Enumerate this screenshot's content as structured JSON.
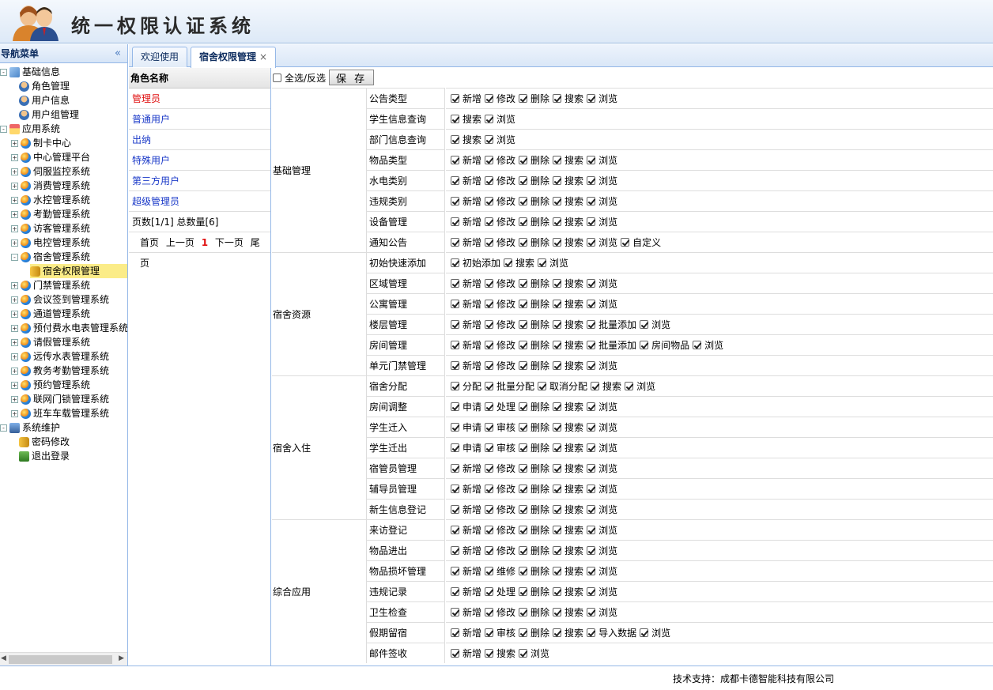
{
  "header": {
    "title": "统一权限认证系统"
  },
  "sidebar": {
    "title": "导航菜单",
    "tree": [
      {
        "label": "基础信息",
        "level": 0,
        "toggle": "-",
        "icon": "folder"
      },
      {
        "label": "角色管理",
        "level": 2,
        "icon": "user"
      },
      {
        "label": "用户信息",
        "level": 2,
        "icon": "user"
      },
      {
        "label": "用户组管理",
        "level": 2,
        "icon": "user"
      },
      {
        "label": "应用系统",
        "level": 0,
        "toggle": "-",
        "icon": "home"
      },
      {
        "label": "制卡中心",
        "level": 1,
        "toggle": "+",
        "icon": "ball"
      },
      {
        "label": "中心管理平台",
        "level": 1,
        "toggle": "+",
        "icon": "ball"
      },
      {
        "label": "伺服监控系统",
        "level": 1,
        "toggle": "+",
        "icon": "ball"
      },
      {
        "label": "消费管理系统",
        "level": 1,
        "toggle": "+",
        "icon": "ball"
      },
      {
        "label": "水控管理系统",
        "level": 1,
        "toggle": "+",
        "icon": "ball"
      },
      {
        "label": "考勤管理系统",
        "level": 1,
        "toggle": "+",
        "icon": "ball"
      },
      {
        "label": "访客管理系统",
        "level": 1,
        "toggle": "+",
        "icon": "ball"
      },
      {
        "label": "电控管理系统",
        "level": 1,
        "toggle": "+",
        "icon": "ball"
      },
      {
        "label": "宿舍管理系统",
        "level": 1,
        "toggle": "-",
        "icon": "ball"
      },
      {
        "label": "宿舍权限管理",
        "level": 3,
        "icon": "key",
        "selected": true
      },
      {
        "label": "门禁管理系统",
        "level": 1,
        "toggle": "+",
        "icon": "ball"
      },
      {
        "label": "会议签到管理系统",
        "level": 1,
        "toggle": "+",
        "icon": "ball"
      },
      {
        "label": "通道管理系统",
        "level": 1,
        "toggle": "+",
        "icon": "ball"
      },
      {
        "label": "预付费水电表管理系统",
        "level": 1,
        "toggle": "+",
        "icon": "ball"
      },
      {
        "label": "请假管理系统",
        "level": 1,
        "toggle": "+",
        "icon": "ball"
      },
      {
        "label": "远传水表管理系统",
        "level": 1,
        "toggle": "+",
        "icon": "ball"
      },
      {
        "label": "教务考勤管理系统",
        "level": 1,
        "toggle": "+",
        "icon": "ball"
      },
      {
        "label": "预约管理系统",
        "level": 1,
        "toggle": "+",
        "icon": "ball"
      },
      {
        "label": "联网门锁管理系统",
        "level": 1,
        "toggle": "+",
        "icon": "ball"
      },
      {
        "label": "班车车载管理系统",
        "level": 1,
        "toggle": "+",
        "icon": "ball"
      },
      {
        "label": "系统维护",
        "level": 0,
        "toggle": "-",
        "icon": "pc"
      },
      {
        "label": "密码修改",
        "level": 2,
        "icon": "key"
      },
      {
        "label": "退出登录",
        "level": 2,
        "icon": "exit"
      }
    ]
  },
  "tabs": [
    {
      "label": "欢迎使用",
      "active": false
    },
    {
      "label": "宿舍权限管理",
      "active": true,
      "close": "×"
    }
  ],
  "roles": {
    "header": "角色名称",
    "items": [
      "管理员",
      "普通用户",
      "出纳",
      "特殊用户",
      "第三方用户",
      "超级管理员"
    ],
    "current": 0,
    "info": "页数[1/1]  总数量[6]",
    "pager": {
      "first": "首页",
      "prev": "上一页",
      "page": "1",
      "next": "下一页",
      "last": "尾页"
    }
  },
  "toolbar": {
    "select_all": "全选/反选",
    "save": "保 存"
  },
  "groups": [
    {
      "name": "基础管理",
      "modules": [
        {
          "name": "公告类型",
          "actions": [
            "新增",
            "修改",
            "删除",
            "搜索",
            "浏览"
          ]
        },
        {
          "name": "学生信息查询",
          "actions": [
            "搜索",
            "浏览"
          ]
        },
        {
          "name": "部门信息查询",
          "actions": [
            "搜索",
            "浏览"
          ]
        },
        {
          "name": "物品类型",
          "actions": [
            "新增",
            "修改",
            "删除",
            "搜索",
            "浏览"
          ]
        },
        {
          "name": "水电类别",
          "actions": [
            "新增",
            "修改",
            "删除",
            "搜索",
            "浏览"
          ]
        },
        {
          "name": "违规类别",
          "actions": [
            "新增",
            "修改",
            "删除",
            "搜索",
            "浏览"
          ]
        },
        {
          "name": "设备管理",
          "actions": [
            "新增",
            "修改",
            "删除",
            "搜索",
            "浏览"
          ]
        },
        {
          "name": "通知公告",
          "actions": [
            "新增",
            "修改",
            "删除",
            "搜索",
            "浏览",
            "自定义"
          ]
        }
      ]
    },
    {
      "name": "宿舍资源",
      "modules": [
        {
          "name": "初始快速添加",
          "actions": [
            "初始添加",
            "搜索",
            "浏览"
          ]
        },
        {
          "name": "区域管理",
          "actions": [
            "新增",
            "修改",
            "删除",
            "搜索",
            "浏览"
          ]
        },
        {
          "name": "公寓管理",
          "actions": [
            "新增",
            "修改",
            "删除",
            "搜索",
            "浏览"
          ]
        },
        {
          "name": "楼层管理",
          "actions": [
            "新增",
            "修改",
            "删除",
            "搜索",
            "批量添加",
            "浏览"
          ]
        },
        {
          "name": "房间管理",
          "actions": [
            "新增",
            "修改",
            "删除",
            "搜索",
            "批量添加",
            "房间物品",
            "浏览"
          ]
        },
        {
          "name": "单元门禁管理",
          "actions": [
            "新增",
            "修改",
            "删除",
            "搜索",
            "浏览"
          ]
        }
      ]
    },
    {
      "name": "宿舍入住",
      "modules": [
        {
          "name": "宿舍分配",
          "actions": [
            "分配",
            "批量分配",
            "取消分配",
            "搜索",
            "浏览"
          ]
        },
        {
          "name": "房间调整",
          "actions": [
            "申请",
            "处理",
            "删除",
            "搜索",
            "浏览"
          ]
        },
        {
          "name": "学生迁入",
          "actions": [
            "申请",
            "审核",
            "删除",
            "搜索",
            "浏览"
          ]
        },
        {
          "name": "学生迁出",
          "actions": [
            "申请",
            "审核",
            "删除",
            "搜索",
            "浏览"
          ]
        },
        {
          "name": "宿管员管理",
          "actions": [
            "新增",
            "修改",
            "删除",
            "搜索",
            "浏览"
          ]
        },
        {
          "name": "辅导员管理",
          "actions": [
            "新增",
            "修改",
            "删除",
            "搜索",
            "浏览"
          ]
        },
        {
          "name": "新生信息登记",
          "actions": [
            "新增",
            "修改",
            "删除",
            "搜索",
            "浏览"
          ]
        }
      ]
    },
    {
      "name": "综合应用",
      "modules": [
        {
          "name": "来访登记",
          "actions": [
            "新增",
            "修改",
            "删除",
            "搜索",
            "浏览"
          ]
        },
        {
          "name": "物品进出",
          "actions": [
            "新增",
            "修改",
            "删除",
            "搜索",
            "浏览"
          ]
        },
        {
          "name": "物品损坏管理",
          "actions": [
            "新增",
            "维修",
            "删除",
            "搜索",
            "浏览"
          ]
        },
        {
          "name": "违规记录",
          "actions": [
            "新增",
            "处理",
            "删除",
            "搜索",
            "浏览"
          ]
        },
        {
          "name": "卫生检查",
          "actions": [
            "新增",
            "修改",
            "删除",
            "搜索",
            "浏览"
          ]
        },
        {
          "name": "假期留宿",
          "actions": [
            "新增",
            "审核",
            "删除",
            "搜索",
            "导入数据",
            "浏览"
          ]
        },
        {
          "name": "邮件签收",
          "actions": [
            "新增",
            "搜索",
            "浏览"
          ]
        }
      ]
    }
  ],
  "footer": {
    "text": "技术支持：成都卡德智能科技有限公司"
  }
}
